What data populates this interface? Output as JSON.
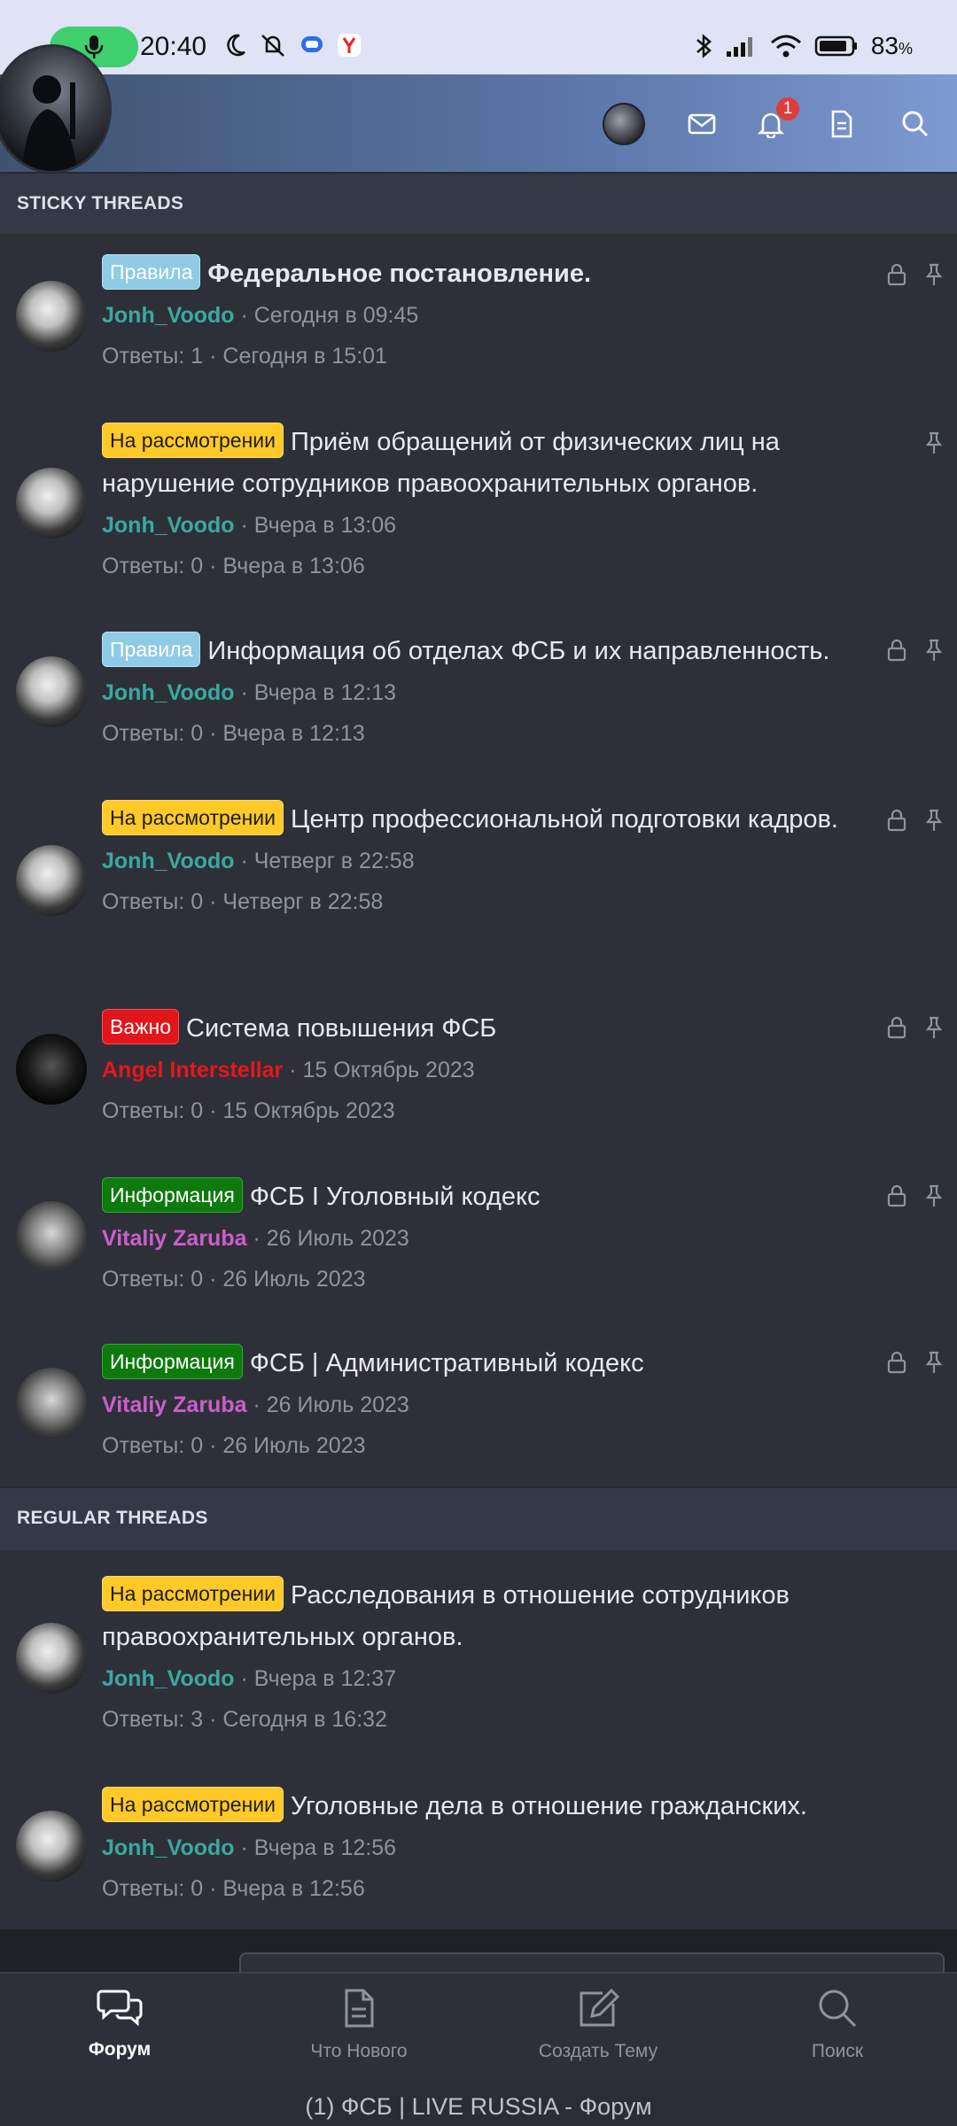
{
  "status_bar": {
    "time": "20:40",
    "battery": "83",
    "battery_unit": "%",
    "icons_left": [
      "moon-icon",
      "mute-icon",
      "message-app-icon",
      "yandex-icon"
    ],
    "icons_right": [
      "bluetooth-icon",
      "signal-icon",
      "wifi-icon",
      "battery-icon"
    ]
  },
  "header": {
    "notification_count": "1",
    "buttons": [
      "user-avatar",
      "mail-icon",
      "bell-icon",
      "document-icon",
      "search-icon"
    ]
  },
  "sections": {
    "sticky": "STICKY THREADS",
    "regular": "REGULAR THREADS"
  },
  "threads": [
    {
      "prefix": "Правила",
      "title": "Федеральное постановление.",
      "author": "Jonh_Voodo",
      "date": "Сегодня в 09:45",
      "stats": "Ответы: 1 · Сегодня в 15:01"
    },
    {
      "prefix": "На рассмотрении",
      "title": "Приём обращений от физических лиц на нарушение сотрудников правоохранительных органов.",
      "author": "Jonh_Voodo",
      "date": "Вчера в 13:06",
      "stats": "Ответы: 0 · Вчера в 13:06"
    },
    {
      "prefix": "Правила",
      "title": "Информация об отделах ФСБ и их направленность.",
      "author": "Jonh_Voodo",
      "date": "Вчера в 12:13",
      "stats": "Ответы: 0 · Вчера в 12:13"
    },
    {
      "prefix": "На рассмотрении",
      "title": "Центр профессиональной подготовки кадров.",
      "author": "Jonh_Voodo",
      "date": "Четверг в 22:58",
      "stats": "Ответы: 0 · Четверг в 22:58"
    },
    {
      "prefix": "Важно",
      "title": "Система повышения ФСБ",
      "author": "Angel Interstellar",
      "date": "15 Октябрь 2023",
      "stats": "Ответы: 0 · 15 Октябрь 2023"
    },
    {
      "prefix": "Информация",
      "title": "ФСБ I Уголовный кодекс",
      "author": "Vitaliy Zaruba",
      "date": "26 Июль 2023",
      "stats": "Ответы: 0 · 26 Июль 2023"
    },
    {
      "prefix": "Информация",
      "title": "ФСБ | Административный кодекс",
      "author": "Vitaliy Zaruba",
      "date": "26 Июль 2023",
      "stats": "Ответы: 0 · 26 Июль 2023"
    },
    {
      "prefix": "На рассмотрении",
      "title": "Расследования в отношение сотрудников правоохранительных органов.",
      "author": "Jonh_Voodo",
      "date": "Вчера в 12:37",
      "stats": "Ответы: 3 · Сегодня в 16:32"
    },
    {
      "prefix": "На рассмотрении",
      "title": "Уголовные дела в отношение гражданских.",
      "author": "Jonh_Voodo",
      "date": "Вчера в 12:56",
      "stats": "Ответы: 0 · Вчера в 12:56"
    }
  ],
  "bottom_nav": [
    {
      "label": "Форум",
      "icon": "forum-icon"
    },
    {
      "label": "Что Нового",
      "icon": "whats-new-icon"
    },
    {
      "label": "Создать Тему",
      "icon": "create-thread-icon"
    },
    {
      "label": "Поиск",
      "icon": "search-icon"
    }
  ],
  "browser_title": "(1) ФСБ | LIVE RUSSIA - Форум",
  "colors": {
    "background": "#2e3039",
    "rules_prefix": "#8fcbe6",
    "review_prefix": "#ffc928",
    "important_prefix": "#e0161c",
    "info_prefix": "#0e7a0e",
    "author_teal": "#3aa9a0",
    "author_red": "#e8161c",
    "author_pink": "#cb5fc9"
  }
}
